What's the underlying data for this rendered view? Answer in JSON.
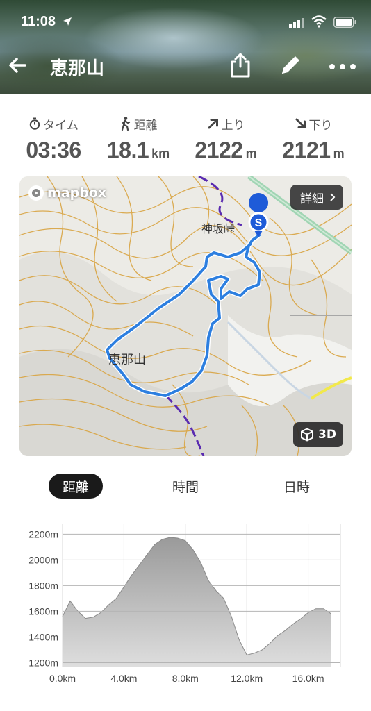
{
  "status": {
    "time": "11:08"
  },
  "header": {
    "title": "恵那山"
  },
  "stats": [
    {
      "icon": "stopwatch-icon",
      "label": "タイム",
      "value": "03:36",
      "unit": ""
    },
    {
      "icon": "hiker-icon",
      "label": "距離",
      "value": "18.1",
      "unit": "km"
    },
    {
      "icon": "arrow-up-right-icon",
      "label": "上り",
      "value": "2122",
      "unit": "m"
    },
    {
      "icon": "arrow-down-right-icon",
      "label": "下り",
      "value": "2121",
      "unit": "m"
    }
  ],
  "map": {
    "logo": "mapbox",
    "detail_label": "詳細",
    "btn_3d_label": "3D",
    "start_marker": "S",
    "labels": [
      "神坂峠",
      "恵那山"
    ]
  },
  "tabs": {
    "items": [
      "距離",
      "時間",
      "日時"
    ],
    "active": 0
  },
  "colors": {
    "route": "#2d7fe0",
    "contour": "#d9a441",
    "trail": "#5a2bb0"
  },
  "chart_data": {
    "type": "area",
    "x": [
      0.0,
      0.5,
      1.0,
      1.5,
      2.0,
      2.5,
      3.0,
      3.5,
      4.0,
      4.5,
      5.0,
      5.5,
      6.0,
      6.5,
      7.0,
      7.5,
      8.0,
      8.5,
      9.0,
      9.5,
      10.0,
      10.5,
      11.0,
      11.5,
      12.0,
      12.5,
      13.0,
      13.5,
      14.0,
      14.5,
      15.0,
      15.5,
      16.0,
      16.5,
      17.0,
      17.5
    ],
    "y": [
      1560,
      1680,
      1600,
      1545,
      1555,
      1590,
      1650,
      1700,
      1790,
      1880,
      1960,
      2040,
      2120,
      2160,
      2175,
      2170,
      2150,
      2080,
      1980,
      1840,
      1760,
      1700,
      1560,
      1380,
      1260,
      1275,
      1300,
      1350,
      1410,
      1450,
      1500,
      1540,
      1590,
      1620,
      1620,
      1580
    ],
    "xlabel": "",
    "ylabel": "",
    "x_ticks": [
      "0.0km",
      "4.0km",
      "8.0km",
      "12.0km",
      "16.0km"
    ],
    "x_tick_values": [
      0,
      4,
      8,
      12,
      16
    ],
    "y_ticks": [
      "1200m",
      "1400m",
      "1600m",
      "1800m",
      "2000m",
      "2200m"
    ],
    "y_tick_values": [
      1200,
      1400,
      1600,
      1800,
      2000,
      2200
    ],
    "xlim": [
      0,
      18.1
    ],
    "ylim": [
      1170,
      2240
    ],
    "grid": true
  }
}
